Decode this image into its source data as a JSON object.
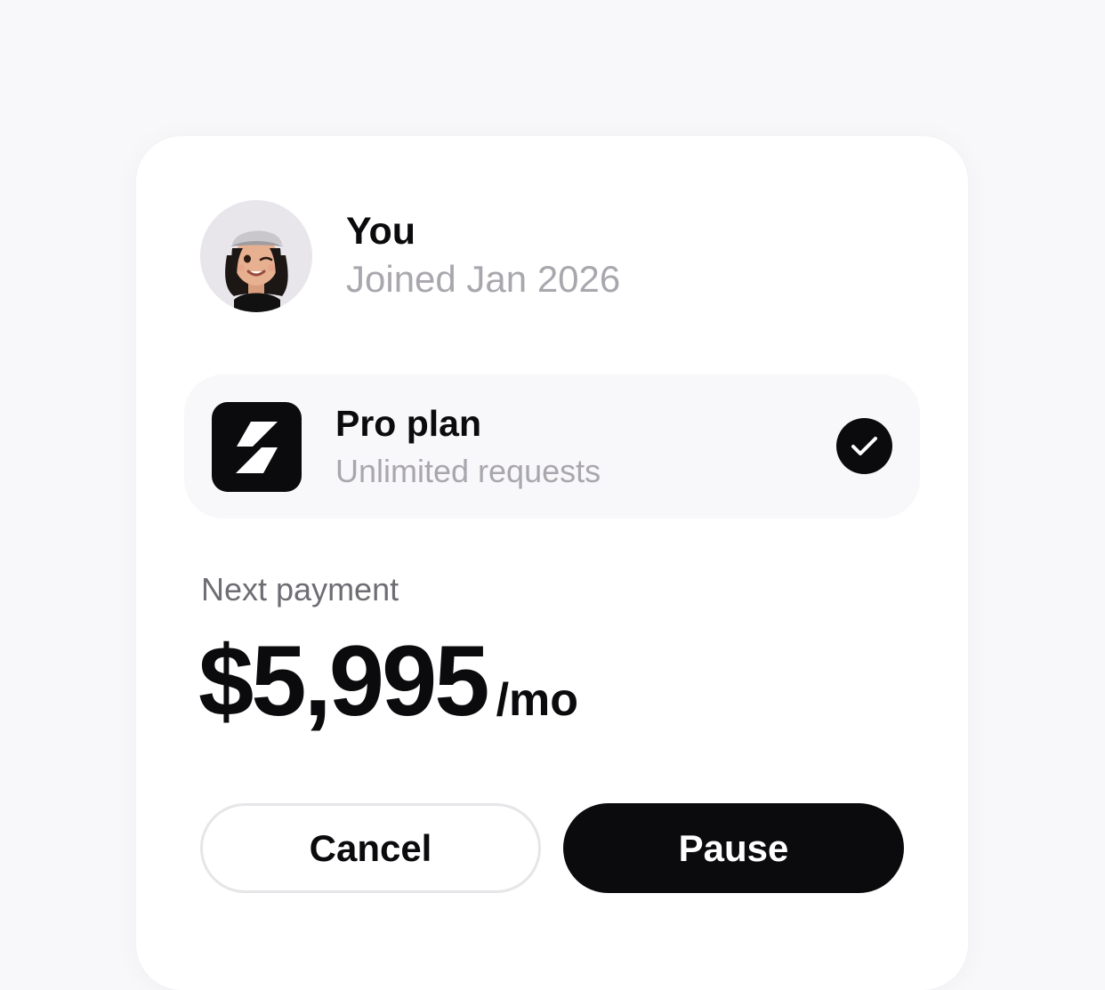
{
  "profile": {
    "name": "You",
    "joined": "Joined Jan 2026",
    "avatar_icon": "memoji-avatar"
  },
  "plan": {
    "icon": "lightning-bolt-icon",
    "title": "Pro plan",
    "subtitle": "Unlimited requests",
    "selected": true,
    "status_icon": "checkmark-icon"
  },
  "payment": {
    "label": "Next payment",
    "amount": "$5,995",
    "period": "/mo"
  },
  "actions": {
    "cancel_label": "Cancel",
    "pause_label": "Pause"
  },
  "colors": {
    "background": "#f8f7f9",
    "card": "#ffffff",
    "primary": "#0b0a0d",
    "muted_text": "#a9a7ad",
    "label_text": "#6f6d74",
    "button_border": "#e6e5e8"
  }
}
